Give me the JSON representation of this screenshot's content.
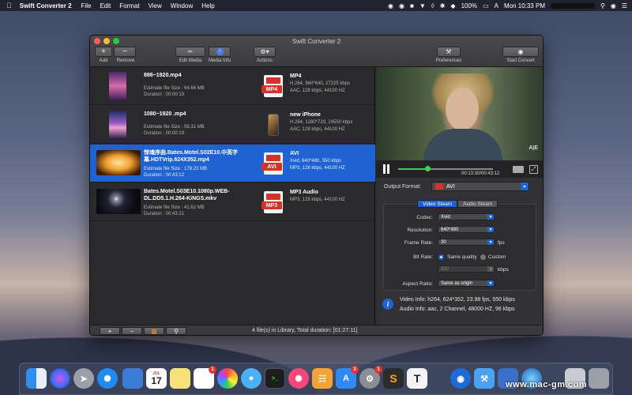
{
  "menubar": {
    "app_name": "Swift Converter 2",
    "menus": [
      "File",
      "Edit",
      "Format",
      "View",
      "Window",
      "Help"
    ],
    "battery": "100%",
    "clock": "Mon 10:33 PM"
  },
  "window": {
    "title": "Swift Converter 2",
    "toolbar": {
      "add_label": "Add",
      "remove_label": "Remove",
      "edit_media_label": "Edit Media",
      "media_info_label": "Media Info",
      "actions_label": "Actions",
      "preferences_label": "Preferences",
      "start_convert_label": "Start Convert"
    }
  },
  "files": [
    {
      "name": "886~1920.mp4",
      "size": "Estimate file Size : 64.66 MB",
      "duration": "Duration : 00:00:19",
      "format": "MP4",
      "format_tag": "MP4",
      "video": "H.264, 960*640, 27225 kbps",
      "audio": "AAC, 128 kbps, 44100 HZ",
      "selected": false
    },
    {
      "name": "1080~1920 .mp4",
      "size": "Estimate file Size : 58.31 MB",
      "duration": "Duration : 00:00:19",
      "format": "new iPhone",
      "format_tag": "",
      "video": "H.264, 1280*720, 24550 kbps",
      "audio": "AAC, 128 kbps, 44100 HZ",
      "selected": false
    },
    {
      "name": "惊魂序曲.Bates.Motel.S02E10.中英字幕.HDTVrip.624X352.mp4",
      "size": "Estimate file Size : 178.23 MB",
      "duration": "Duration : 00:43:12",
      "format": "AVI",
      "format_tag": "AVI",
      "video": "Xvid, 640*480, 550 kbps",
      "audio": "MP3, 128 kbps, 44100 HZ",
      "selected": true
    },
    {
      "name": "Bates.Motel.S03E10.1080p.WEB-DL.DD5.1.H.264-KiNGS.mkv",
      "size": "Estimate file Size : 41.62 MB",
      "duration": "Duration : 00:43:21",
      "format": "MP3 Audio",
      "format_tag": "MP3",
      "video": "MP3, 128 kbps, 44100 HZ",
      "audio": "",
      "selected": false
    }
  ],
  "status": "4 file(s) in Library, Total duration: [01:27:11]",
  "player": {
    "timecode": "00:13:30/00:43:12",
    "progress": 0.31,
    "channel_logo": "A|E"
  },
  "output": {
    "label": "Output Format:",
    "format": "AVI",
    "tabs": [
      "Video Steam",
      "Audio Steam"
    ],
    "active_tab": 0,
    "codec_label": "Codec:",
    "codec": "Xvid",
    "resolution_label": "Resolution:",
    "resolution": "640*480",
    "framerate_label": "Frame Rate:",
    "framerate": "30",
    "framerate_unit": "fps",
    "bitrate_label": "Bit Rate:",
    "bitrate_same": "Same quality",
    "bitrate_custom": "Custom",
    "bitrate_value": "550",
    "bitrate_unit": "kbps",
    "aspect_label": "Aspect Ratio:",
    "aspect": "Same as origin"
  },
  "info": {
    "video": "Video Info: h264, 624*352, 23.98 fps, 550 kbps",
    "audio": "Audio Info: aac, 2 Channel, 48000 HZ, 96 kbps"
  },
  "dock": {
    "calendar_day": "17",
    "calendar_month": "JUL",
    "notes_badge": "1",
    "appstore_badge": "3",
    "prefs_badge": "1"
  },
  "watermark": "www.mac-gm.com",
  "colors": {
    "accent": "#1e63d1",
    "progress": "#39d353",
    "format_red": "#d4332a"
  }
}
